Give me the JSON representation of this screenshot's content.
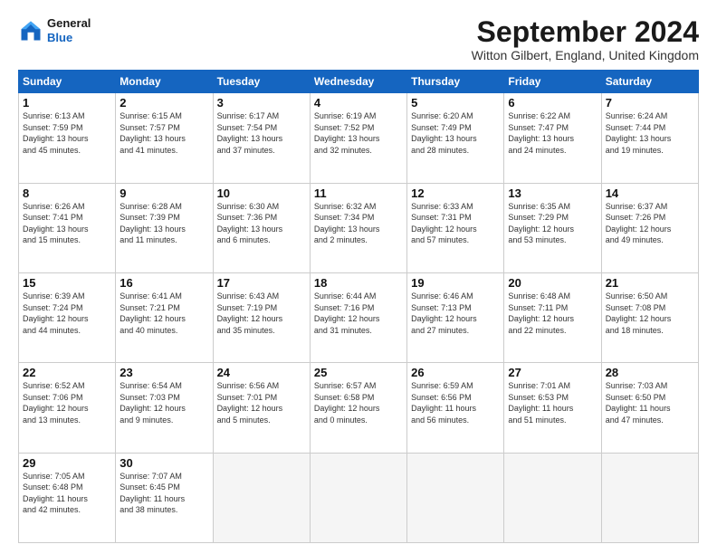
{
  "header": {
    "logo_general": "General",
    "logo_blue": "Blue",
    "month_title": "September 2024",
    "subtitle": "Witton Gilbert, England, United Kingdom"
  },
  "days_of_week": [
    "Sunday",
    "Monday",
    "Tuesday",
    "Wednesday",
    "Thursday",
    "Friday",
    "Saturday"
  ],
  "weeks": [
    [
      {
        "day": "1",
        "info": "Sunrise: 6:13 AM\nSunset: 7:59 PM\nDaylight: 13 hours\nand 45 minutes."
      },
      {
        "day": "2",
        "info": "Sunrise: 6:15 AM\nSunset: 7:57 PM\nDaylight: 13 hours\nand 41 minutes."
      },
      {
        "day": "3",
        "info": "Sunrise: 6:17 AM\nSunset: 7:54 PM\nDaylight: 13 hours\nand 37 minutes."
      },
      {
        "day": "4",
        "info": "Sunrise: 6:19 AM\nSunset: 7:52 PM\nDaylight: 13 hours\nand 32 minutes."
      },
      {
        "day": "5",
        "info": "Sunrise: 6:20 AM\nSunset: 7:49 PM\nDaylight: 13 hours\nand 28 minutes."
      },
      {
        "day": "6",
        "info": "Sunrise: 6:22 AM\nSunset: 7:47 PM\nDaylight: 13 hours\nand 24 minutes."
      },
      {
        "day": "7",
        "info": "Sunrise: 6:24 AM\nSunset: 7:44 PM\nDaylight: 13 hours\nand 19 minutes."
      }
    ],
    [
      {
        "day": "8",
        "info": "Sunrise: 6:26 AM\nSunset: 7:41 PM\nDaylight: 13 hours\nand 15 minutes."
      },
      {
        "day": "9",
        "info": "Sunrise: 6:28 AM\nSunset: 7:39 PM\nDaylight: 13 hours\nand 11 minutes."
      },
      {
        "day": "10",
        "info": "Sunrise: 6:30 AM\nSunset: 7:36 PM\nDaylight: 13 hours\nand 6 minutes."
      },
      {
        "day": "11",
        "info": "Sunrise: 6:32 AM\nSunset: 7:34 PM\nDaylight: 13 hours\nand 2 minutes."
      },
      {
        "day": "12",
        "info": "Sunrise: 6:33 AM\nSunset: 7:31 PM\nDaylight: 12 hours\nand 57 minutes."
      },
      {
        "day": "13",
        "info": "Sunrise: 6:35 AM\nSunset: 7:29 PM\nDaylight: 12 hours\nand 53 minutes."
      },
      {
        "day": "14",
        "info": "Sunrise: 6:37 AM\nSunset: 7:26 PM\nDaylight: 12 hours\nand 49 minutes."
      }
    ],
    [
      {
        "day": "15",
        "info": "Sunrise: 6:39 AM\nSunset: 7:24 PM\nDaylight: 12 hours\nand 44 minutes."
      },
      {
        "day": "16",
        "info": "Sunrise: 6:41 AM\nSunset: 7:21 PM\nDaylight: 12 hours\nand 40 minutes."
      },
      {
        "day": "17",
        "info": "Sunrise: 6:43 AM\nSunset: 7:19 PM\nDaylight: 12 hours\nand 35 minutes."
      },
      {
        "day": "18",
        "info": "Sunrise: 6:44 AM\nSunset: 7:16 PM\nDaylight: 12 hours\nand 31 minutes."
      },
      {
        "day": "19",
        "info": "Sunrise: 6:46 AM\nSunset: 7:13 PM\nDaylight: 12 hours\nand 27 minutes."
      },
      {
        "day": "20",
        "info": "Sunrise: 6:48 AM\nSunset: 7:11 PM\nDaylight: 12 hours\nand 22 minutes."
      },
      {
        "day": "21",
        "info": "Sunrise: 6:50 AM\nSunset: 7:08 PM\nDaylight: 12 hours\nand 18 minutes."
      }
    ],
    [
      {
        "day": "22",
        "info": "Sunrise: 6:52 AM\nSunset: 7:06 PM\nDaylight: 12 hours\nand 13 minutes."
      },
      {
        "day": "23",
        "info": "Sunrise: 6:54 AM\nSunset: 7:03 PM\nDaylight: 12 hours\nand 9 minutes."
      },
      {
        "day": "24",
        "info": "Sunrise: 6:56 AM\nSunset: 7:01 PM\nDaylight: 12 hours\nand 5 minutes."
      },
      {
        "day": "25",
        "info": "Sunrise: 6:57 AM\nSunset: 6:58 PM\nDaylight: 12 hours\nand 0 minutes."
      },
      {
        "day": "26",
        "info": "Sunrise: 6:59 AM\nSunset: 6:56 PM\nDaylight: 11 hours\nand 56 minutes."
      },
      {
        "day": "27",
        "info": "Sunrise: 7:01 AM\nSunset: 6:53 PM\nDaylight: 11 hours\nand 51 minutes."
      },
      {
        "day": "28",
        "info": "Sunrise: 7:03 AM\nSunset: 6:50 PM\nDaylight: 11 hours\nand 47 minutes."
      }
    ],
    [
      {
        "day": "29",
        "info": "Sunrise: 7:05 AM\nSunset: 6:48 PM\nDaylight: 11 hours\nand 42 minutes."
      },
      {
        "day": "30",
        "info": "Sunrise: 7:07 AM\nSunset: 6:45 PM\nDaylight: 11 hours\nand 38 minutes."
      },
      {
        "day": "",
        "info": ""
      },
      {
        "day": "",
        "info": ""
      },
      {
        "day": "",
        "info": ""
      },
      {
        "day": "",
        "info": ""
      },
      {
        "day": "",
        "info": ""
      }
    ]
  ]
}
